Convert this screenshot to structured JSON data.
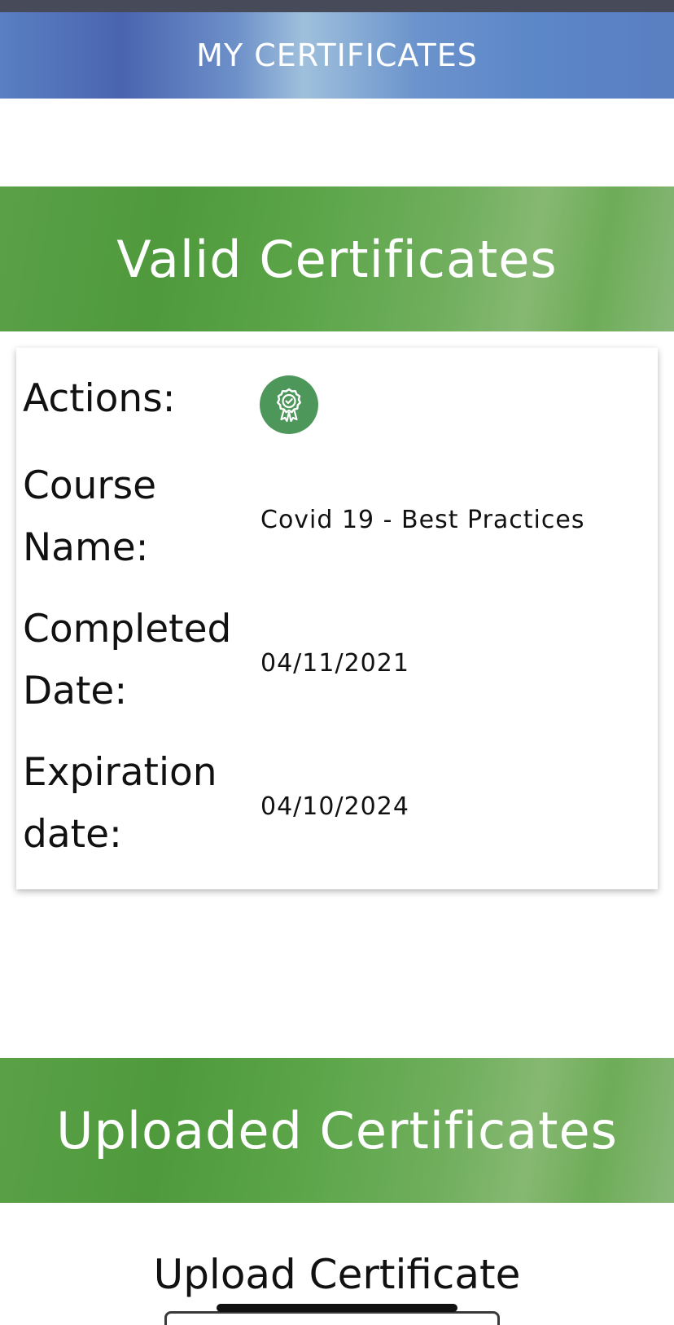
{
  "header": {
    "title": "MY CERTIFICATES"
  },
  "valid_section": {
    "title": "Valid Certificates",
    "certificate": {
      "actions_label": "Actions:",
      "action_icon": "certificate-badge-icon",
      "course_label": "Course Name:",
      "course_value": "Covid 19 - Best Practices",
      "completed_label": "Completed Date:",
      "completed_value": "04/11/2021",
      "expiration_label": "Expiration date:",
      "expiration_value": "04/10/2024"
    }
  },
  "uploaded_section": {
    "title": "Uploaded Certificates",
    "upload_label": "Upload Certificate"
  },
  "colors": {
    "header_blue": "#5a7fc2",
    "section_green": "#5aa047",
    "action_green": "#4e975a"
  }
}
